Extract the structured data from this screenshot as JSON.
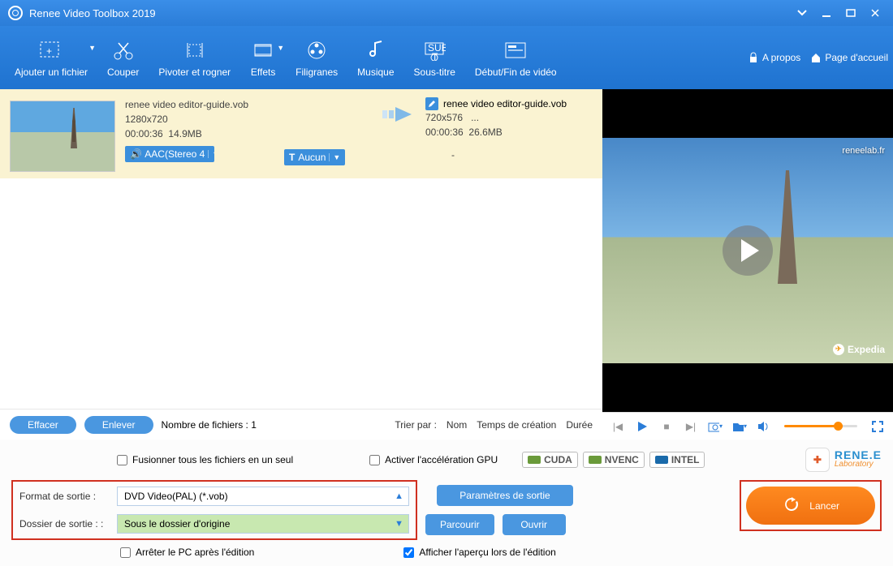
{
  "titlebar": {
    "title": "Renee Video Toolbox 2019"
  },
  "toolbar": {
    "add": "Ajouter un fichier",
    "cut": "Couper",
    "rotate": "Pivoter et rogner",
    "effects": "Effets",
    "watermark": "Filigranes",
    "music": "Musique",
    "subtitle": "Sous-titre",
    "startend": "Début/Fin de vidéo",
    "about": "A propos",
    "home": "Page d'accueil"
  },
  "file": {
    "src_name": "renee video editor-guide.vob",
    "src_res": "1280x720",
    "src_dur": "00:00:36",
    "src_size": "14.9MB",
    "audio": "AAC(Stereo 4",
    "sub_label": "Aucun",
    "dst_name": "renee video editor-guide.vob",
    "dst_res": "720x576",
    "dst_extra": "...",
    "dst_dur": "00:00:36",
    "dst_size": "26.6MB",
    "dash": "-"
  },
  "preview": {
    "watermark": "reneelab.fr",
    "brand": "Expedia"
  },
  "listfooter": {
    "clear": "Effacer",
    "remove": "Enlever",
    "count": "Nombre de fichiers : 1",
    "sortby": "Trier par :",
    "name": "Nom",
    "created": "Temps de création",
    "duration": "Durée"
  },
  "options": {
    "merge": "Fusionner tous les fichiers en un seul",
    "gpu": "Activer l'accélération GPU",
    "hw": {
      "cuda": "CUDA",
      "nvenc": "NVENC",
      "intel": "INTEL"
    },
    "brand": {
      "name": "RENE.E",
      "sub": "Laboratory"
    }
  },
  "output": {
    "format_label": "Format de sortie :",
    "format_value": "DVD Video(PAL) (*.vob)",
    "folder_label": "Dossier de sortie :",
    "folder_value": "Sous le dossier d'origine",
    "params": "Paramètres de sortie",
    "browse": "Parcourir",
    "open": "Ouvrir",
    "shutdown": "Arrêter le PC après l'édition",
    "preview": "Afficher l'aperçu lors de l'édition",
    "launch": "Lancer"
  }
}
